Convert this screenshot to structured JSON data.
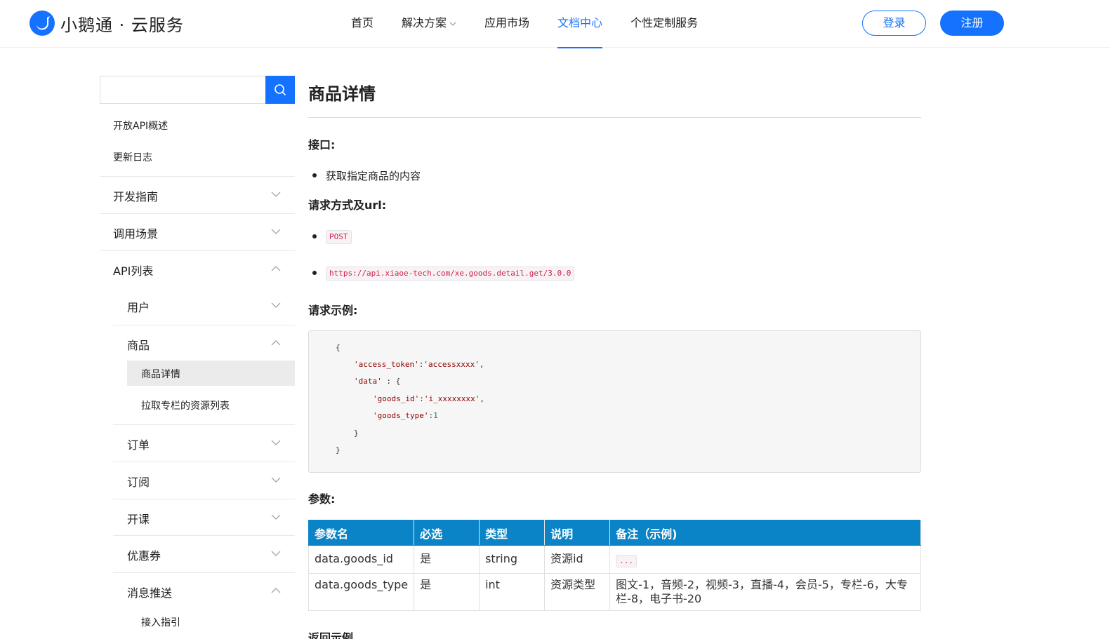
{
  "header": {
    "brand": "小鹅通 · 云服务",
    "nav": [
      {
        "label": "首页",
        "active": false
      },
      {
        "label": "解决方案",
        "active": false,
        "has_dropdown": true
      },
      {
        "label": "应用市场",
        "active": false
      },
      {
        "label": "文档中心",
        "active": true
      },
      {
        "label": "个性定制服务",
        "active": false
      }
    ],
    "login_label": "登录",
    "register_label": "注册"
  },
  "sidebar": {
    "search_placeholder": "",
    "links": [
      "开放API概述",
      "更新日志"
    ],
    "groups": {
      "dev_guide": {
        "label": "开发指南",
        "expanded": false
      },
      "scenarios": {
        "label": "调用场景",
        "expanded": false
      },
      "api_list": {
        "label": "API列表",
        "expanded": true
      }
    },
    "api_sub": {
      "user": {
        "label": "用户",
        "expanded": false
      },
      "goods": {
        "label": "商品",
        "expanded": true
      },
      "order": {
        "label": "订单",
        "expanded": false
      },
      "subscribe": {
        "label": "订阅",
        "expanded": false
      },
      "course": {
        "label": "开课",
        "expanded": false
      },
      "coupon": {
        "label": "优惠券",
        "expanded": false
      },
      "push": {
        "label": "消息推送",
        "expanded": true
      }
    },
    "goods_items": [
      "商品详情",
      "拉取专栏的资源列表"
    ],
    "push_items": [
      "接入指引"
    ],
    "selected": "商品详情"
  },
  "main": {
    "title": "商品详情",
    "interface_heading": "接口:",
    "interface_desc": "获取指定商品的内容",
    "method_heading": "请求方式及url:",
    "method": "POST",
    "url": "https://api.xiaoe-tech.com/xe.goods.detail.get/3.0.0",
    "example_heading": "请求示例:",
    "code": {
      "l1": "{",
      "l2_key": "'access_token'",
      "l2_sep": ":",
      "l2_val": "'accessxxxx'",
      "l2_end": ",",
      "l3_key": "'data'",
      "l3_rest": " : {",
      "l4_key": "'goods_id'",
      "l4_sep": ":",
      "l4_val": "'i_xxxxxxxx'",
      "l4_end": ",",
      "l5_key": "'goods_type'",
      "l5_sep": ":",
      "l5_val": "1",
      "l6": "}",
      "l7": "}"
    },
    "params_heading": "参数:",
    "table": {
      "headers": [
        "参数名",
        "必选",
        "类型",
        "说明",
        "备注（示例)"
      ],
      "rows": [
        {
          "name": "data.goods_id",
          "required": "是",
          "type": "string",
          "desc": "资源id",
          "note": "..."
        },
        {
          "name": "data.goods_type",
          "required": "是",
          "type": "int",
          "desc": "资源类型",
          "note": "图文-1，音频-2，视频-3，直播-4，会员-5，专栏-6，大专栏-8，电子书-20"
        }
      ]
    },
    "return_heading": "返回示例"
  },
  "colors": {
    "accent": "#1472ff",
    "table_header": "#0a84c6",
    "code_inline": "#c7254e"
  }
}
